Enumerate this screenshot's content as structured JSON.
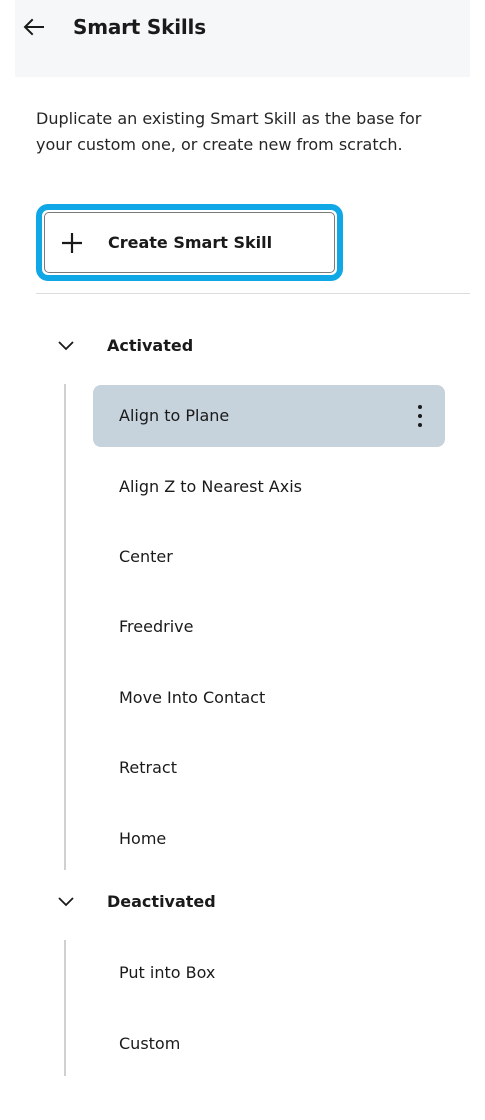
{
  "header": {
    "title": "Smart Skills",
    "back_icon": "arrow-left-icon"
  },
  "description": "Duplicate an existing Smart Skill as the base for your custom one, or create new from scratch.",
  "create_button": {
    "label": "Create Smart Skill",
    "icon": "plus-icon",
    "focus_color": "#0fa7e6"
  },
  "groups": [
    {
      "label": "Activated",
      "expanded": true,
      "items": [
        {
          "label": "Align to Plane",
          "selected": true
        },
        {
          "label": "Align Z to Nearest Axis"
        },
        {
          "label": "Center"
        },
        {
          "label": "Freedrive"
        },
        {
          "label": "Move Into Contact"
        },
        {
          "label": "Retract"
        },
        {
          "label": "Home"
        }
      ]
    },
    {
      "label": "Deactivated",
      "expanded": true,
      "items": [
        {
          "label": "Put into Box"
        },
        {
          "label": "Custom"
        }
      ]
    }
  ],
  "colors": {
    "selected_bg": "#c6d2dc",
    "header_bg": "#f6f7f8"
  }
}
